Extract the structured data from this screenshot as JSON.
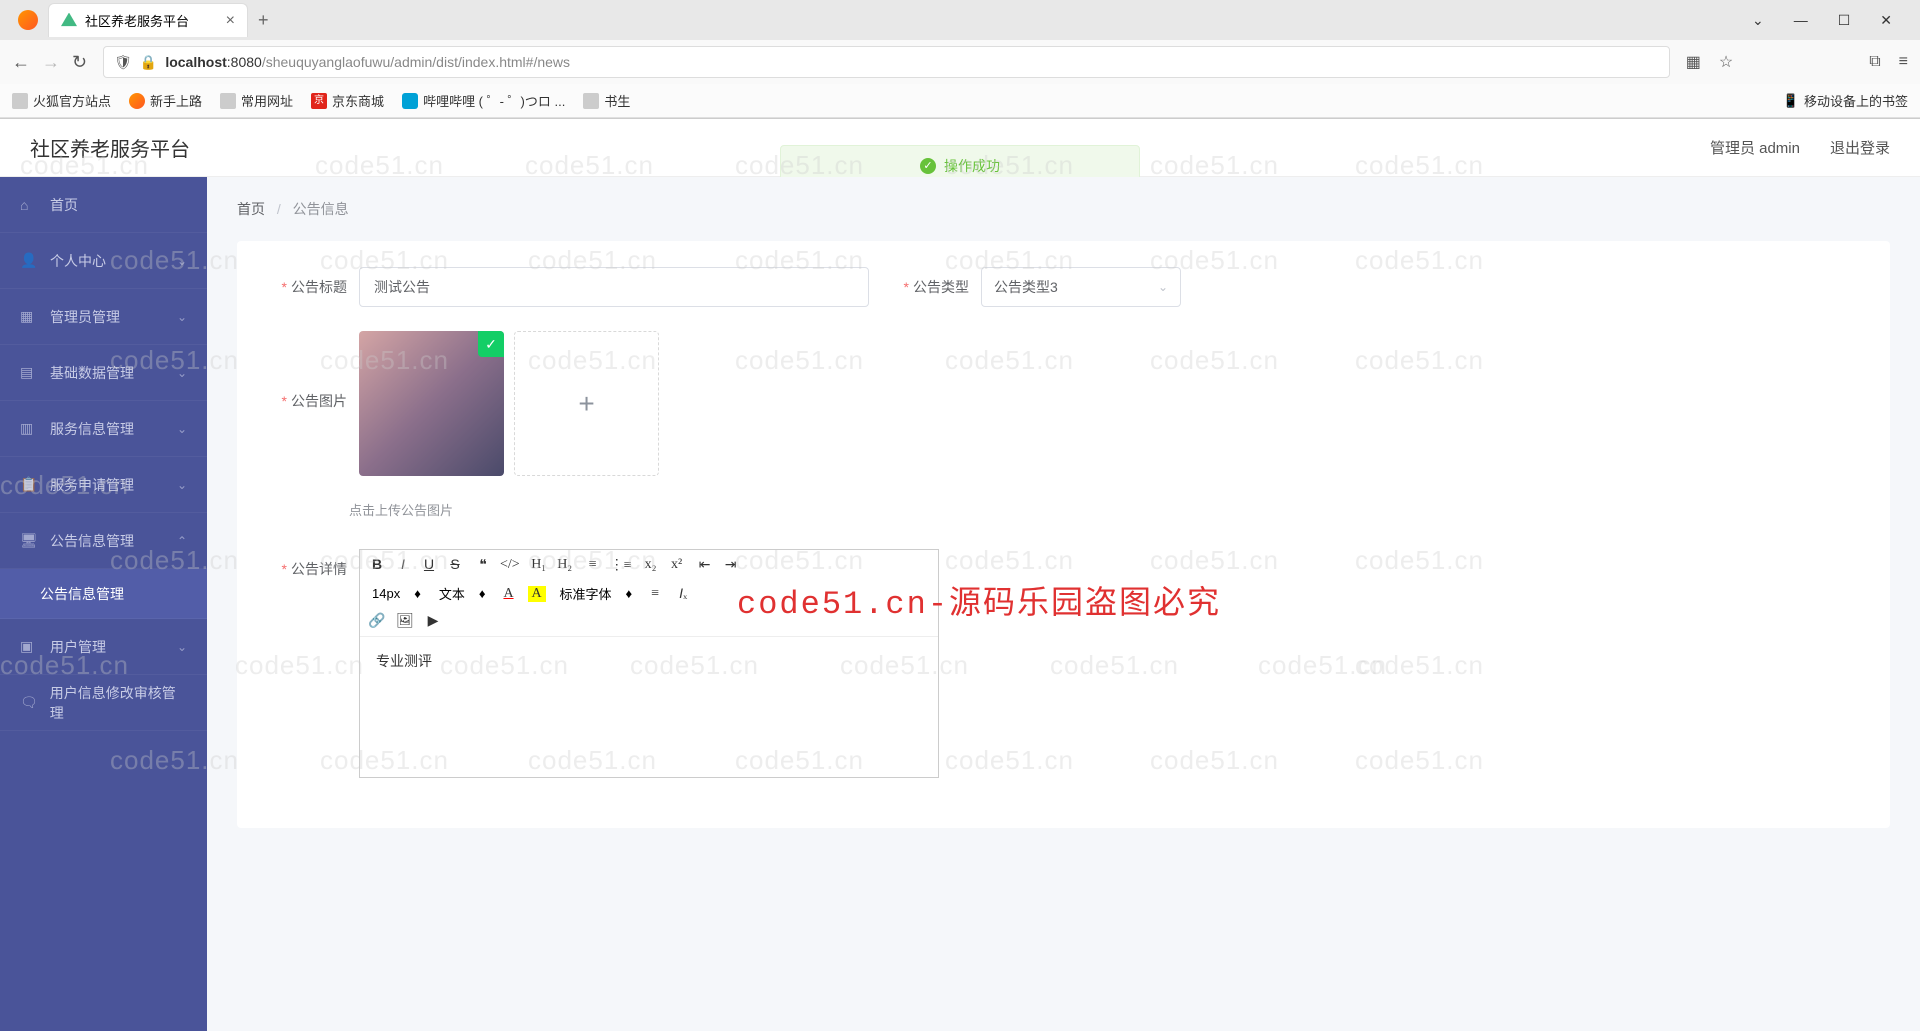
{
  "browser": {
    "tab_title": "社区养老服务平台",
    "url_host": "localhost",
    "url_port": ":8080",
    "url_path": "/sheuquyanglaofuwu/admin/dist/index.html#/news",
    "bookmarks": [
      "火狐官方站点",
      "新手上路",
      "常用网址",
      "京东商城",
      "哔哩哔哩 ( ゜- ゜)つロ ...",
      "书生"
    ],
    "mobile_bookmarks": "移动设备上的书签"
  },
  "header": {
    "app_title": "社区养老服务平台",
    "user_label": "管理员 admin",
    "logout": "退出登录"
  },
  "toast": "操作成功",
  "sidebar": {
    "items": [
      {
        "label": "首页",
        "icon": "home",
        "expandable": false
      },
      {
        "label": "个人中心",
        "icon": "user",
        "expandable": true
      },
      {
        "label": "管理员管理",
        "icon": "admin",
        "expandable": true
      },
      {
        "label": "基础数据管理",
        "icon": "data",
        "expandable": true
      },
      {
        "label": "服务信息管理",
        "icon": "service",
        "expandable": true
      },
      {
        "label": "服务申请管理",
        "icon": "apply",
        "expandable": true
      },
      {
        "label": "公告信息管理",
        "icon": "notice",
        "expandable": true,
        "expanded": true
      },
      {
        "label": "公告信息管理",
        "sub": true
      },
      {
        "label": "用户管理",
        "icon": "users",
        "expandable": true
      },
      {
        "label": "用户信息修改审核管理",
        "icon": "audit",
        "expandable": true
      }
    ]
  },
  "breadcrumb": {
    "home": "首页",
    "current": "公告信息"
  },
  "form": {
    "title_label": "公告标题",
    "title_value": "测试公告",
    "type_label": "公告类型",
    "type_value": "公告类型3",
    "image_label": "公告图片",
    "upload_hint": "点击上传公告图片",
    "detail_label": "公告详情",
    "editor_font_size": "14px",
    "editor_style": "文本",
    "editor_font": "标准字体",
    "editor_content": "专业测评"
  },
  "watermark_text": "code51.cn",
  "big_watermark": "code51.cn-源码乐园盗图必究"
}
